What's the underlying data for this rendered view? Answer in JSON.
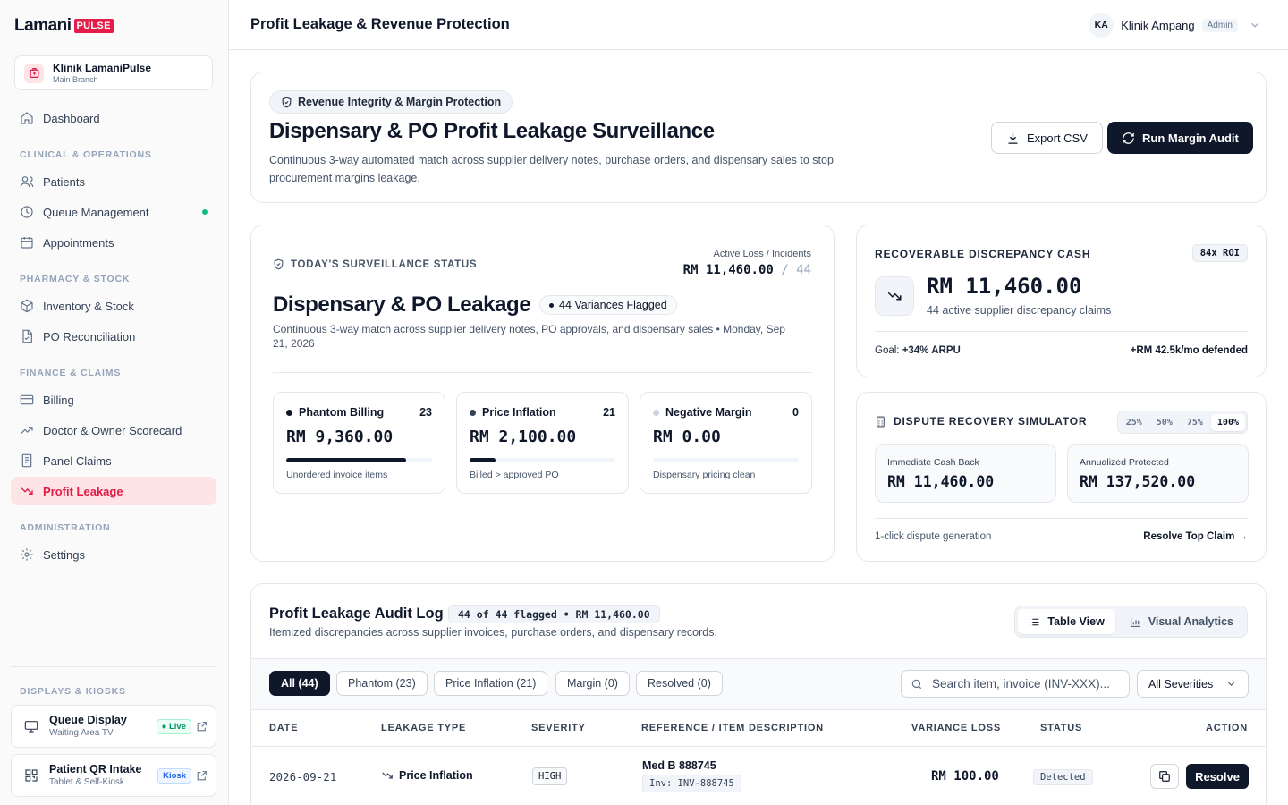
{
  "brand": {
    "word": "Lamani",
    "badge": "PULSE"
  },
  "clinic": {
    "name": "Klinik LamaniPulse",
    "branch": "Main Branch"
  },
  "nav": {
    "dashboard": "Dashboard",
    "sections": {
      "clinical": "CLINICAL & OPERATIONS",
      "pharmacy": "PHARMACY & STOCK",
      "finance": "FINANCE & CLAIMS",
      "admin": "ADMINISTRATION",
      "displays": "DISPLAYS & KIOSKS"
    },
    "patients": "Patients",
    "queue": "Queue Management",
    "appointments": "Appointments",
    "inventory": "Inventory & Stock",
    "po": "PO Reconciliation",
    "billing": "Billing",
    "scorecard": "Doctor & Owner Scorecard",
    "panel": "Panel Claims",
    "leakage": "Profit Leakage",
    "settings": "Settings"
  },
  "kiosks": [
    {
      "title": "Queue Display",
      "sub": "Waiting Area TV",
      "pill": "Live"
    },
    {
      "title": "Patient QR Intake",
      "sub": "Tablet & Self-Kiosk",
      "pill": "Kiosk"
    }
  ],
  "header": {
    "title": "Profit Leakage & Revenue Protection",
    "initials": "KA",
    "user": "Klinik Ampang",
    "role": "Admin"
  },
  "hero": {
    "pill": "Revenue Integrity & Margin Protection",
    "title": "Dispensary & PO Profit Leakage Surveillance",
    "desc": "Continuous 3-way automated match across supplier delivery notes, purchase orders, and dispensary sales to stop procurement margins leakage.",
    "export": "Export CSV",
    "audit": "Run Margin Audit"
  },
  "status": {
    "label": "TODAY'S SURVEILLANCE STATUS",
    "active_label": "Active Loss / Incidents",
    "active_amount": "RM 11,460.00",
    "active_sep": "/",
    "active_count": "44",
    "title": "Dispensary & PO Leakage",
    "flag": "44 Variances Flagged",
    "desc": "Continuous 3-way match across supplier delivery notes, PO approvals, and dispensary sales • Monday, Sep 21, 2026",
    "metrics": [
      {
        "name": "Phantom Billing",
        "count": "23",
        "value": "RM 9,360.00",
        "note": "Unordered invoice items",
        "fill": 0.82,
        "dot": "#0f172a"
      },
      {
        "name": "Price Inflation",
        "count": "21",
        "value": "RM 2,100.00",
        "note": "Billed > approved PO",
        "fill": 0.18,
        "dot": "#334155"
      },
      {
        "name": "Negative Margin",
        "count": "0",
        "value": "RM 0.00",
        "note": "Dispensary pricing clean",
        "fill": 0,
        "dot": "#cbd5e1"
      }
    ]
  },
  "recover": {
    "label": "RECOVERABLE DISCREPANCY CASH",
    "roi": "84x ROI",
    "amount": "RM 11,460.00",
    "sub": "44 active supplier discrepancy claims",
    "goal_label": "Goal:",
    "goal_value": "+34% ARPU",
    "defended": "+RM 42.5k/mo defended"
  },
  "simulator": {
    "label": "DISPUTE RECOVERY SIMULATOR",
    "options": [
      "25%",
      "50%",
      "75%",
      "100%"
    ],
    "immediate_label": "Immediate Cash Back",
    "immediate_value": "RM 11,460.00",
    "annual_label": "Annualized Protected",
    "annual_value": "RM 137,520.00",
    "foot": "1-click dispute generation",
    "link": "Resolve Top Claim →"
  },
  "log": {
    "title": "Profit Leakage Audit Log",
    "pill": "44 of 44 flagged • RM 11,460.00",
    "sub": "Itemized discrepancies across supplier invoices, purchase orders, and dispensary records.",
    "views": [
      "Table View",
      "Visual Analytics"
    ],
    "chips": [
      "All (44)",
      "Phantom (23)",
      "Price Inflation (21)",
      "Margin (0)",
      "Resolved (0)"
    ],
    "search_placeholder": "Search item, invoice (INV-XXX)...",
    "severity_select": "All Severities",
    "columns": [
      "DATE",
      "LEAKAGE TYPE",
      "SEVERITY",
      "REFERENCE / ITEM DESCRIPTION",
      "VARIANCE LOSS",
      "STATUS",
      "ACTION"
    ],
    "row": {
      "date": "2026-09-21",
      "type": "Price Inflation",
      "severity": "HIGH",
      "item": "Med B 888745",
      "invoice": "Inv: INV-888745",
      "loss": "RM 100.00",
      "status": "Detected",
      "action": "Resolve"
    }
  },
  "colors": {
    "accent": "#e11d48",
    "accent_bg": "#ffe4e6",
    "dark": "#0f172a",
    "live": "#10b981",
    "kiosk": "#2563eb"
  }
}
